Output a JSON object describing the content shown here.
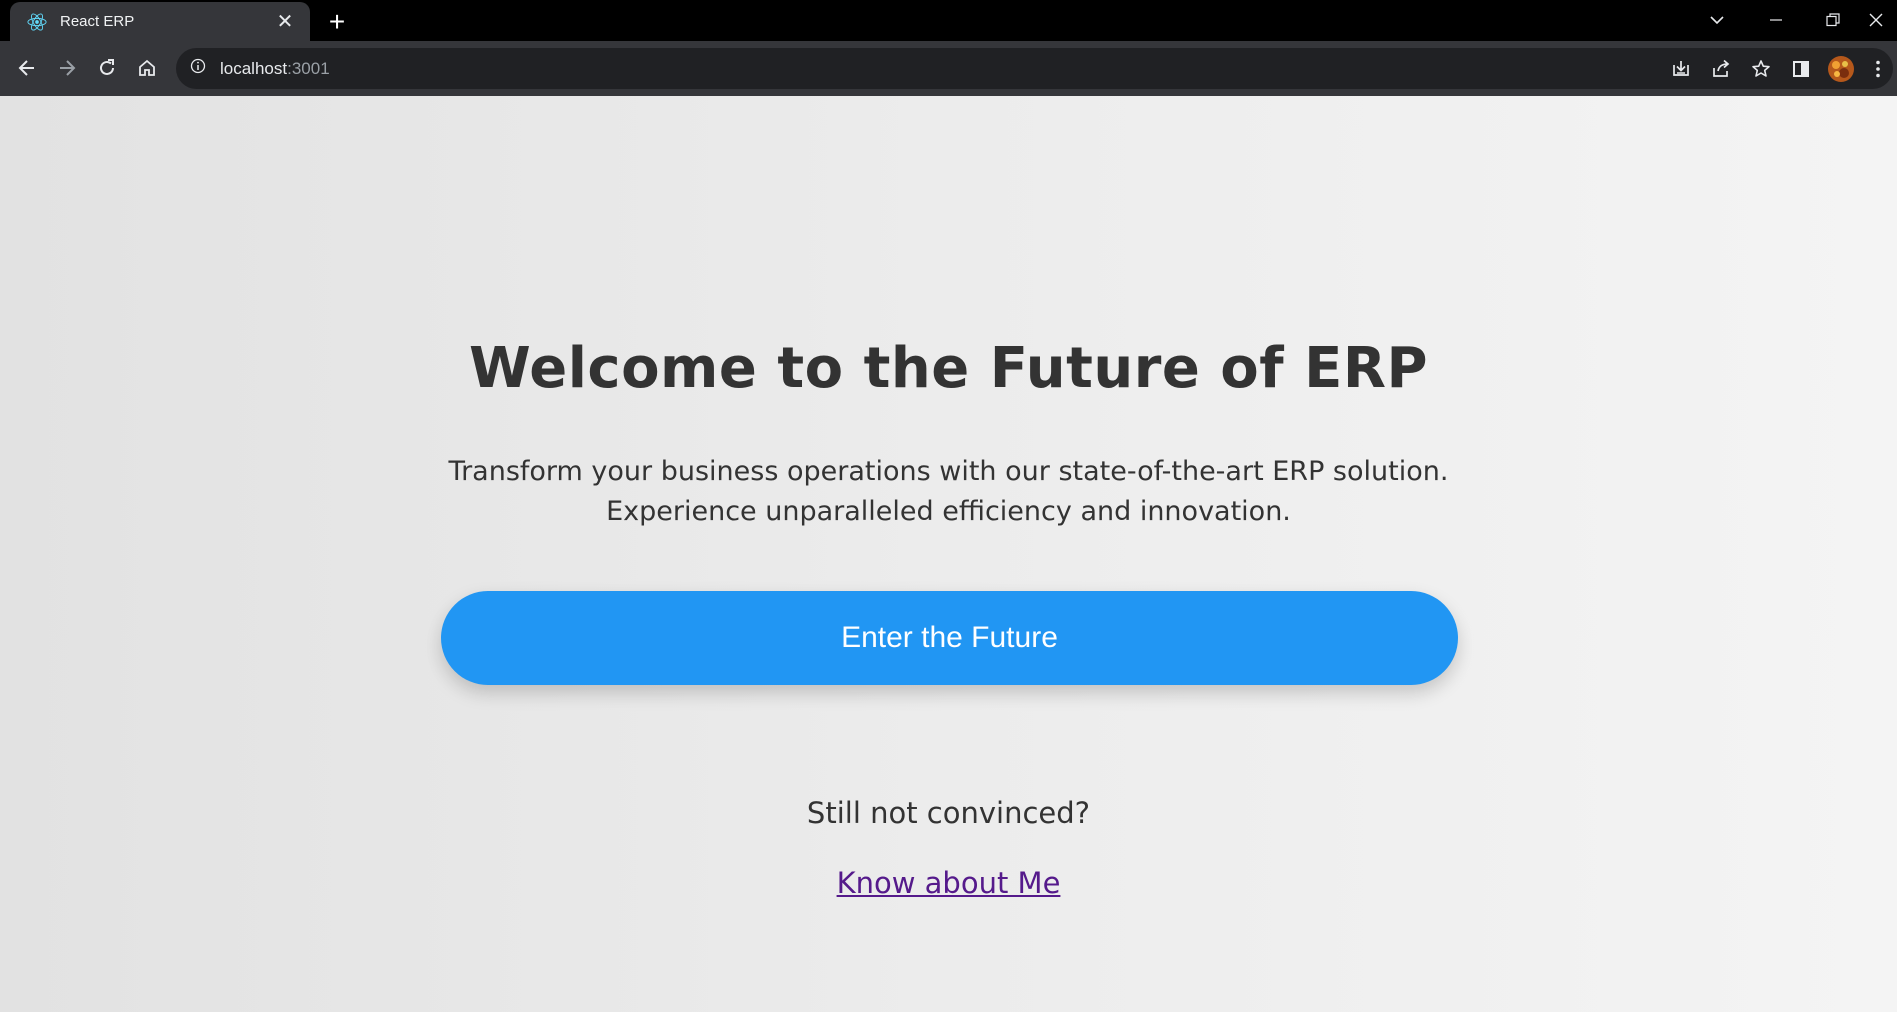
{
  "browser": {
    "tab": {
      "title": "React ERP",
      "close_glyph": "✕"
    },
    "new_tab_glyph": "+",
    "address": {
      "host": "localhost",
      "port": ":3001"
    }
  },
  "page": {
    "headline": "Welcome to the Future of ERP",
    "subtitle_line1": "Transform your business operations with our state-of-the-art ERP solution.",
    "subtitle_line2": "Experience unparalleled efficiency and innovation.",
    "cta_label": "Enter the Future",
    "prompt_text": "Still not convinced?",
    "link_text": "Know about Me"
  },
  "colors": {
    "cta_background": "#2196f3",
    "visited_link": "#551a8b",
    "heading_text": "#333333"
  }
}
